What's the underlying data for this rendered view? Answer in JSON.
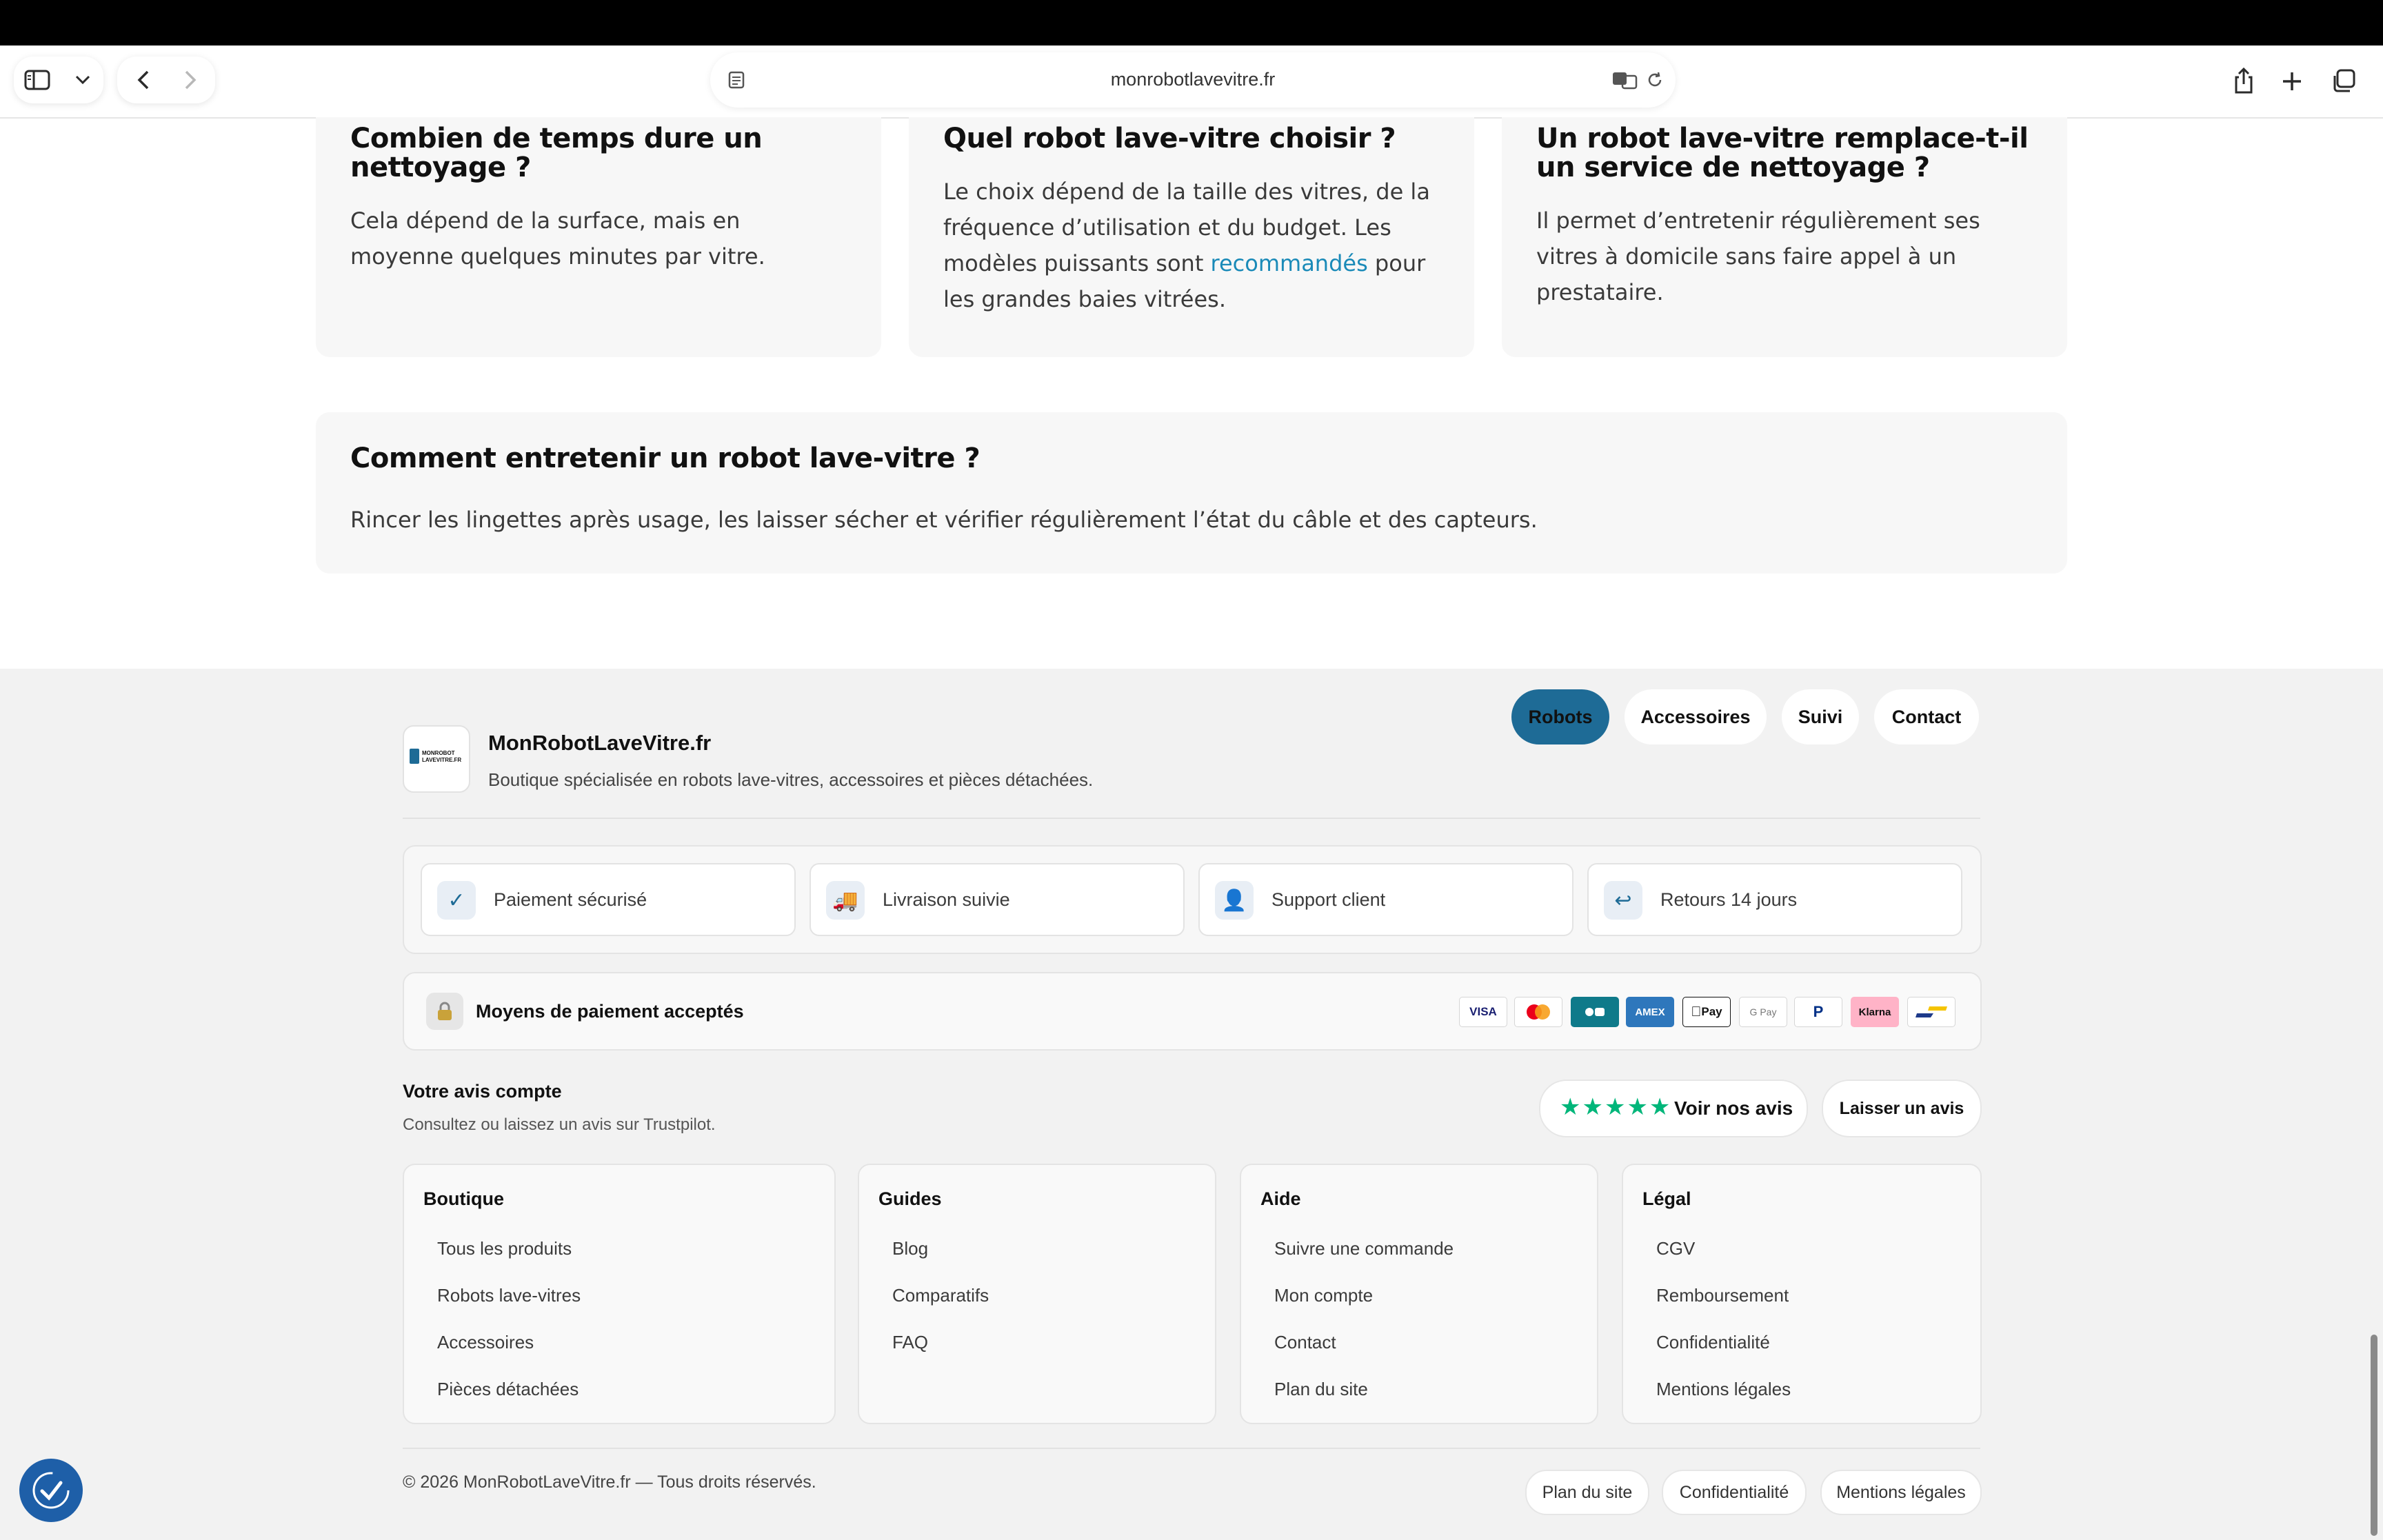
{
  "browser": {
    "url": "monrobotlavevitre.fr"
  },
  "faq": [
    {
      "title_lines": [
        "Combien de temps dure un",
        "nettoyage ?"
      ],
      "text_lines": [
        "Cela dépend de la surface, mais en",
        "moyenne quelques minutes par vitre."
      ]
    },
    {
      "title_lines": [
        "Quel robot lave-vitre choisir ?"
      ],
      "text_lines": [
        "Le choix dépend de la taille des vitres, de la",
        "fréquence d’utilisation et du budget. Les"
      ],
      "line3_before": "modèles puissants sont ",
      "line3_link": "recommandés",
      "line3_after": " pour",
      "line4": "les grandes baies vitrées."
    },
    {
      "title_lines": [
        "Un robot lave-vitre remplace-t-il",
        "un service de nettoyage ?"
      ],
      "text_lines": [
        "Il permet d’entretenir régulièrement ses",
        "vitres à domicile sans faire appel à un",
        "prestataire."
      ]
    },
    {
      "title_lines": [
        "Comment entretenir un robot lave-vitre ?"
      ],
      "text_lines": [
        "Rincer les lingettes après usage, les laisser sécher et vérifier régulièrement l’état du câble et des capteurs."
      ]
    }
  ],
  "footer": {
    "brand": {
      "logo_text_1": "MONROBOT",
      "logo_text_2": "LAVEVITRE.FR",
      "name": "MonRobotLaveVitre.fr",
      "tagline": "Boutique spécialisée en robots lave-vitres, accessoires et pièces détachées."
    },
    "nav": [
      "Robots",
      "Accessoires",
      "Suivi",
      "Contact"
    ],
    "nav_active_color": "#1e6b96",
    "features": [
      {
        "icon": "check-icon",
        "glyph": "✓",
        "label": "Paiement sécurisé"
      },
      {
        "icon": "truck-icon",
        "glyph": "🚚",
        "label": "Livraison suivie"
      },
      {
        "icon": "user-icon",
        "glyph": "👤",
        "label": "Support client"
      },
      {
        "icon": "return-icon",
        "glyph": "↩",
        "label": "Retours 14 jours"
      }
    ],
    "payments": {
      "title": "Moyens de paiement acceptés",
      "cards": [
        "VISA",
        "",
        "",
        "AMEX",
        "Pay",
        "G Pay",
        "P",
        "Klarna",
        ""
      ]
    },
    "reviews": {
      "title": "Votre avis compte",
      "subtitle": "Consultez ou laissez un avis sur Trustpilot.",
      "stars": "★★★★★",
      "see_label": "Voir nos avis",
      "leave_label": "Laisser un avis",
      "star_color": "#00b67a"
    },
    "columns": [
      {
        "title": "Boutique",
        "links": [
          "Tous les produits",
          "Robots lave-vitres",
          "Accessoires",
          "Pièces détachées"
        ]
      },
      {
        "title": "Guides",
        "links": [
          "Blog",
          "Comparatifs",
          "FAQ"
        ]
      },
      {
        "title": "Aide",
        "links": [
          "Suivre une commande",
          "Mon compte",
          "Contact",
          "Plan du site"
        ]
      },
      {
        "title": "Légal",
        "links": [
          "CGV",
          "Remboursement",
          "Confidentialité",
          "Mentions légales"
        ]
      }
    ],
    "copyright": "© 2026 MonRobotLaveVitre.fr — Tous droits réservés.",
    "bottom_links": [
      "Plan du site",
      "Confidentialité",
      "Mentions légales"
    ]
  }
}
